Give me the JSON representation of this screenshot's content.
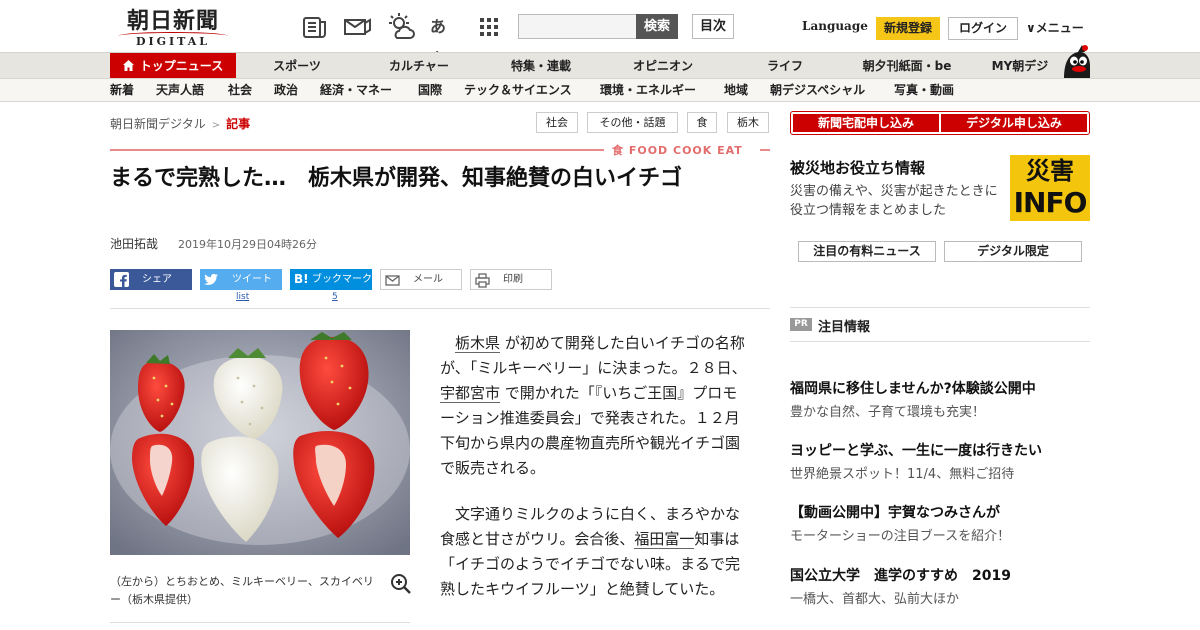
{
  "header": {
    "logo_main": "朝日新聞",
    "logo_sub": "DIGITAL",
    "search_button": "検索",
    "index_button": "目次",
    "language": "Language",
    "register": "新規登録",
    "login": "ログイン",
    "menu": "∨メニュー",
    "icons": [
      "newspaper-icon",
      "mail-icon",
      "weather-icon",
      "font-size-icon",
      "grid-icon"
    ],
    "font_size_glyph": "あぁ"
  },
  "nav_primary": [
    {
      "label": "トップニュース",
      "active": true
    },
    {
      "label": "スポーツ"
    },
    {
      "label": "カルチャー"
    },
    {
      "label": "特集・連載"
    },
    {
      "label": "オピニオン"
    },
    {
      "label": "ライフ"
    },
    {
      "label": "朝夕刊紙面・be"
    },
    {
      "label": "MY朝デジ"
    }
  ],
  "nav_secondary": [
    "新着",
    "天声人語",
    "社会",
    "政治",
    "経済・マネー",
    "国際",
    "テック＆サイエンス",
    "環境・エネルギー",
    "地域",
    "朝デジスペシャル",
    "写真・動画"
  ],
  "breadcrumb": {
    "root": "朝日新聞デジタル",
    "separator": ">",
    "current": "記事"
  },
  "tags": [
    "社会",
    "その他・話題",
    "食",
    "栃木"
  ],
  "section_label": "食 FOOD COOK EAT",
  "article": {
    "title": "まるで完熟した…　栃木県が開発、知事絶賛の白いイチゴ",
    "author": "池田拓哉",
    "date": "2019年10月29日04時26分",
    "share": {
      "facebook": "シェア",
      "tweet": "ツイート",
      "tweet_count": "list",
      "bookmark": "ブックマーク",
      "bookmark_count": "5",
      "mail": "メール",
      "print": "印刷"
    },
    "caption": "（左から）とちおとめ、ミルキーベリー、スカイベリー（栃木県提供）",
    "p1_link1": "栃木県",
    "p1_text1": "が初めて開発した白いイチゴの名称が、「ミルキーベリー」に決まった。２８日、",
    "p1_link2": "宇都宮市",
    "p1_text2": "で開かれた「『いちご王国』プロモーション推進委員会」で発表された。１２月下旬から県内の農産物直売所や観光イチゴ園で販売される。",
    "p2_text1": "文字通りミルクのように白く、まろやかな食感と甘さがウリ。会合後、",
    "p2_link1": "福田富一",
    "p2_text2": "知事は「イチゴのようでイチゴでない味。まるで完熟したキウイフルーツ」と絶賛していた。"
  },
  "sidebar": {
    "cta_newspaper": "新聞宅配申し込み",
    "cta_digital": "デジタル申し込み",
    "disaster_title": "被災地お役立ち情報",
    "disaster_desc": "災害の備えや、災害が起きたときに役立つ情報をまとめました",
    "saigai_top": "災害",
    "saigai_bottom": "INFO",
    "btn_paid_news": "注目の有料ニュース",
    "btn_digital_only": "デジタル限定",
    "pr_badge": "PR",
    "pr_heading": "注目情報",
    "pr_items": [
      {
        "title": "福岡県に移住しませんか?体験談公開中",
        "sub": "豊かな自然、子育て環境も充実！"
      },
      {
        "title": "ヨッピーと学ぶ、一生に一度は行きたい",
        "sub": "世界絶景スポット！11/4、無料ご招待"
      },
      {
        "title": "【動画公開中】宇賀なつみさんが",
        "sub": "モーターショーの注目ブースを紹介！"
      },
      {
        "title": "国公立大学　進学のすすめ　2019",
        "sub": "一橋大、首都大、弘前大ほか"
      }
    ]
  },
  "colors": {
    "brand_red": "#cc0000",
    "nav_bg": "#e7e5e0",
    "register_yellow": "#f5c518",
    "saigai_yellow": "#f3c60d",
    "facebook": "#3b5998",
    "twitter": "#55acee",
    "hatena": "#008fde"
  }
}
